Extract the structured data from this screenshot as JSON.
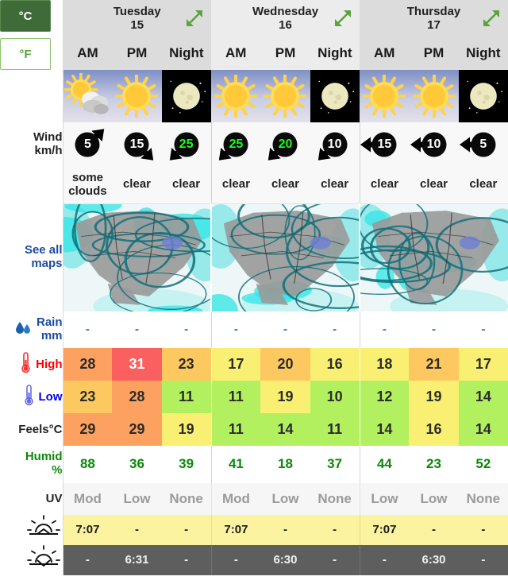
{
  "units": {
    "celsius": "°C",
    "fahrenheit": "°F",
    "active": "celsius"
  },
  "labels": {
    "wind": "Wind",
    "wind_unit": "km/h",
    "see_all_maps_l1": "See all",
    "see_all_maps_l2": "maps",
    "rain": "Rain",
    "rain_unit": "mm",
    "high": "High",
    "low": "Low",
    "feels": "Feels°C",
    "humid": "Humid",
    "humid_unit": "%",
    "uv": "UV"
  },
  "icons": {
    "expand": "expand-arrows-icon",
    "rain_drop": "rain-drop-icon",
    "thermo_high": "thermometer-red-icon",
    "thermo_low": "thermometer-blue-icon",
    "sunrise": "sunrise-icon",
    "sunset": "sunset-icon"
  },
  "colors": {
    "accent_green": "#5aa43c",
    "active_green": "#3f6b38",
    "link_blue": "#1c4ba0",
    "high_red": "#ff0000",
    "low_blue": "#0000ee",
    "humid_green": "#0a8a0a",
    "wind_high": "#1aff1a",
    "sunrise_bg": "#fbf3a0",
    "sunset_bg": "#5e5e5e"
  },
  "days": [
    {
      "name": "Tuesday",
      "date": "15",
      "shade": "a"
    },
    {
      "name": "Wednesday",
      "date": "16",
      "shade": "b"
    },
    {
      "name": "Thursday",
      "date": "17",
      "shade": "c"
    }
  ],
  "slots": [
    "AM",
    "PM",
    "Night",
    "AM",
    "PM",
    "Night",
    "AM",
    "PM",
    "Night"
  ],
  "columns": [
    {
      "day": 0,
      "slot": "AM",
      "period": "day",
      "sky_icon": "sun-behind-cloud-icon",
      "summary_l1": "some",
      "summary_l2": "clouds",
      "wind": 5,
      "wind_dir": "NE",
      "wind_high": false,
      "rain": "-",
      "high": 28,
      "low": 23,
      "feels": 29,
      "humid": 88,
      "uv": "Mod",
      "sunrise": "7:07",
      "sunset": "-",
      "high_bg": "#fca15f",
      "low_bg": "#fcc85f",
      "feels_bg": "#fca15f",
      "high_white": false
    },
    {
      "day": 0,
      "slot": "PM",
      "period": "day",
      "sky_icon": "sun-icon",
      "summary_l1": "clear",
      "summary_l2": "",
      "wind": 15,
      "wind_dir": "SE",
      "wind_high": false,
      "rain": "-",
      "high": 31,
      "low": 28,
      "feels": 29,
      "humid": 36,
      "uv": "Low",
      "sunrise": "-",
      "sunset": "6:31",
      "high_bg": "#f9605f",
      "low_bg": "#fca15f",
      "feels_bg": "#fca15f",
      "high_white": true
    },
    {
      "day": 0,
      "slot": "Night",
      "period": "night",
      "sky_icon": "moon-icon",
      "summary_l1": "clear",
      "summary_l2": "",
      "wind": 25,
      "wind_dir": "SW",
      "wind_high": true,
      "rain": "-",
      "high": 23,
      "low": 11,
      "feels": 19,
      "humid": 39,
      "uv": "None",
      "sunrise": "-",
      "sunset": "-",
      "high_bg": "#fcc85f",
      "low_bg": "#b3f060",
      "feels_bg": "#f9ef72",
      "high_white": false
    },
    {
      "day": 1,
      "slot": "AM",
      "period": "day",
      "sky_icon": "sun-icon",
      "summary_l1": "clear",
      "summary_l2": "",
      "wind": 25,
      "wind_dir": "SW",
      "wind_high": true,
      "rain": "-",
      "high": 17,
      "low": 11,
      "feels": 11,
      "humid": 41,
      "uv": "Mod",
      "sunrise": "7:07",
      "sunset": "-",
      "high_bg": "#f9ef72",
      "low_bg": "#b3f060",
      "feels_bg": "#b3f060",
      "high_white": false
    },
    {
      "day": 1,
      "slot": "PM",
      "period": "day",
      "sky_icon": "sun-icon",
      "summary_l1": "clear",
      "summary_l2": "",
      "wind": 20,
      "wind_dir": "SW",
      "wind_high": true,
      "rain": "-",
      "high": 20,
      "low": 19,
      "feels": 14,
      "humid": 18,
      "uv": "Low",
      "sunrise": "-",
      "sunset": "6:30",
      "high_bg": "#fcc85f",
      "low_bg": "#f9ef72",
      "feels_bg": "#b3f060",
      "high_white": false
    },
    {
      "day": 1,
      "slot": "Night",
      "period": "night",
      "sky_icon": "moon-icon",
      "summary_l1": "clear",
      "summary_l2": "",
      "wind": 10,
      "wind_dir": "SW",
      "wind_high": false,
      "rain": "-",
      "high": 16,
      "low": 10,
      "feels": 11,
      "humid": 37,
      "uv": "None",
      "sunrise": "-",
      "sunset": "-",
      "high_bg": "#f9ef72",
      "low_bg": "#b3f060",
      "feels_bg": "#b3f060",
      "high_white": false
    },
    {
      "day": 2,
      "slot": "AM",
      "period": "day",
      "sky_icon": "sun-icon",
      "summary_l1": "clear",
      "summary_l2": "",
      "wind": 15,
      "wind_dir": "W",
      "wind_high": false,
      "rain": "-",
      "high": 18,
      "low": 12,
      "feels": 14,
      "humid": 44,
      "uv": "Low",
      "sunrise": "7:07",
      "sunset": "-",
      "high_bg": "#f9ef72",
      "low_bg": "#b3f060",
      "feels_bg": "#b3f060",
      "high_white": false
    },
    {
      "day": 2,
      "slot": "PM",
      "period": "day",
      "sky_icon": "sun-icon",
      "summary_l1": "clear",
      "summary_l2": "",
      "wind": 10,
      "wind_dir": "W",
      "wind_high": false,
      "rain": "-",
      "high": 21,
      "low": 19,
      "feels": 16,
      "humid": 23,
      "uv": "Low",
      "sunrise": "-",
      "sunset": "6:30",
      "high_bg": "#fcc85f",
      "low_bg": "#f9ef72",
      "feels_bg": "#f9ef72",
      "high_white": false
    },
    {
      "day": 2,
      "slot": "Night",
      "period": "night",
      "sky_icon": "moon-icon",
      "summary_l1": "clear",
      "summary_l2": "",
      "wind": 5,
      "wind_dir": "W",
      "wind_high": false,
      "rain": "-",
      "high": 17,
      "low": 14,
      "feels": 14,
      "humid": 52,
      "uv": "None",
      "sunrise": "-",
      "sunset": "-",
      "high_bg": "#f9ef72",
      "low_bg": "#b3f060",
      "feels_bg": "#b3f060",
      "high_white": false
    }
  ]
}
